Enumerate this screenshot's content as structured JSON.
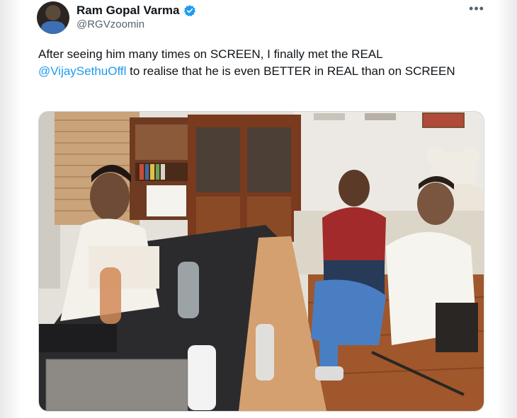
{
  "tweet": {
    "author_name": "Ram Gopal Varma",
    "author_handle": "@RGVzoomin",
    "more_icon": "more-horizontal-icon",
    "verified_icon": "verified-badge-icon",
    "text_part1": "After seeing him many times on SCREEN, I finally met the REAL ",
    "mention": "@VijaySethuOffl",
    "text_part2": " to realise that he is even BETTER in REAL than on SCREEN",
    "colors": {
      "text": "#0f1419",
      "secondary": "#536471",
      "link": "#1d9bf0",
      "verified": "#1d9bf0"
    }
  }
}
